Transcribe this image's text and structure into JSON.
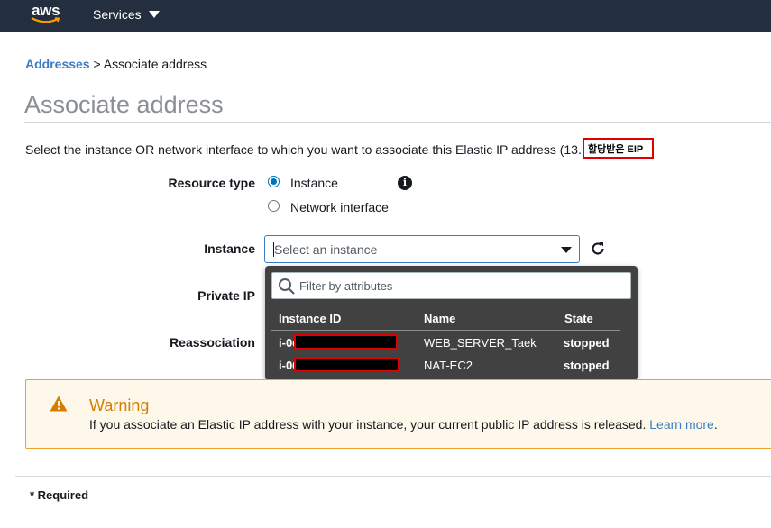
{
  "topbar": {
    "logo_text": "aws",
    "services_label": "Services"
  },
  "breadcrumb": {
    "parent": "Addresses",
    "separator": " > ",
    "current": "Associate address"
  },
  "page": {
    "title": "Associate address",
    "description": "Select the instance OR network interface to which you want to associate this Elastic IP address (13.",
    "eip_annotation": "할당받은 EIP"
  },
  "form": {
    "resource_type_label": "Resource type",
    "resource_options": [
      {
        "label": "Instance",
        "selected": true
      },
      {
        "label": "Network interface",
        "selected": false
      }
    ],
    "instance_label": "Instance",
    "instance_placeholder": "Select an instance",
    "private_ip_label": "Private IP",
    "reassociation_label": "Reassociation"
  },
  "dropdown": {
    "filter_placeholder": "Filter by attributes",
    "columns": [
      "Instance ID",
      "Name",
      "State"
    ],
    "rows": [
      {
        "id_prefix": "i-0e",
        "name": "WEB_SERVER_Taek",
        "state": "stopped"
      },
      {
        "id_prefix": "i-06",
        "name": "NAT-EC2",
        "state": "stopped"
      }
    ]
  },
  "warning": {
    "title": "Warning",
    "text": "If you associate an Elastic IP address with your instance, your current public IP address is released.",
    "link": "Learn more",
    "trailing": "."
  },
  "footer": {
    "required_note": "* Required"
  },
  "colors": {
    "topbar": "#232f3e",
    "link": "#3b7cc7",
    "warning_border": "#e8a22d",
    "warning_bg": "#fef8ea",
    "dropdown_bg": "#414141",
    "redaction_border": "#e00000"
  }
}
